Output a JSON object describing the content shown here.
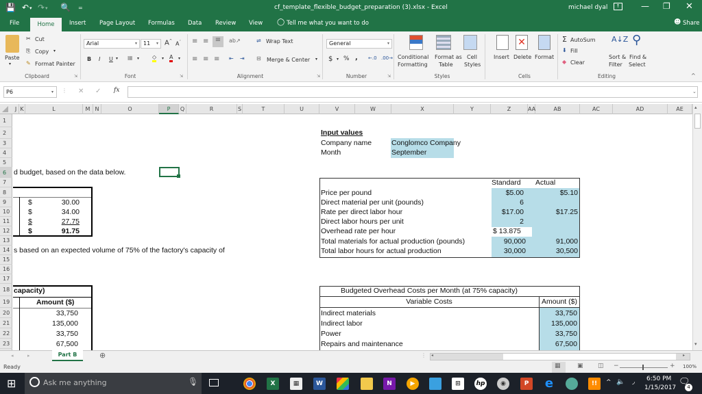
{
  "titlebar": {
    "title": "cf_template_flexible_budget_preparation (3).xlsx  -  Excel",
    "user": "michael dyal",
    "qat": {
      "save": "save-icon",
      "undo": "undo-icon",
      "redo": "redo-icon",
      "print_preview": "print-preview-icon",
      "customize": "customize-qat-icon"
    }
  },
  "menu_tabs": [
    "File",
    "Home",
    "Insert",
    "Page Layout",
    "Formulas",
    "Data",
    "Review",
    "View"
  ],
  "tell_me": "Tell me what you want to do",
  "share": "Share",
  "ribbon": {
    "clipboard": {
      "label": "Clipboard",
      "paste": "Paste",
      "cut": "Cut",
      "copy": "Copy",
      "format_painter": "Format Painter"
    },
    "font": {
      "label": "Font",
      "name": "Arial",
      "size": "11",
      "bold": "B",
      "italic": "I",
      "underline": "U"
    },
    "alignment": {
      "label": "Alignment",
      "wrap_text": "Wrap Text",
      "merge_center": "Merge & Center"
    },
    "number": {
      "label": "Number",
      "format": "General",
      "currency": "$",
      "percent": "%",
      "comma": ","
    },
    "styles": {
      "label": "Styles",
      "conditional": [
        "Conditional",
        "Formatting"
      ],
      "format_table": [
        "Format as",
        "Table"
      ],
      "cell_styles": [
        "Cell",
        "Styles"
      ]
    },
    "cells": {
      "label": "Cells",
      "insert": "Insert",
      "delete": "Delete",
      "format": "Format"
    },
    "editing": {
      "label": "Editing",
      "autosum": "AutoSum",
      "fill": "Fill",
      "clear": "Clear",
      "sort_filter": [
        "Sort &",
        "Filter"
      ],
      "find_select": [
        "Find &",
        "Select"
      ]
    }
  },
  "formula_bar": {
    "name_box": "P6",
    "formula": ""
  },
  "columns": [
    "J",
    "K",
    "L",
    "M",
    "N",
    "O",
    "P",
    "Q",
    "R",
    "S",
    "T",
    "U",
    "V",
    "W",
    "X",
    "Y",
    "Z",
    "AA",
    "AB",
    "AC",
    "AD",
    "AE"
  ],
  "rows": [
    "1",
    "2",
    "3",
    "4",
    "5",
    "6",
    "7",
    "8",
    "9",
    "10",
    "11",
    "12",
    "13",
    "14",
    "15",
    "16",
    "17",
    "18",
    "19",
    "20",
    "21",
    "22",
    "23"
  ],
  "sheet": {
    "row6_text": "d budget, based on the data below.",
    "left_table": {
      "rows": [
        {
          "sym": "$",
          "val": "30.00"
        },
        {
          "sym": "$",
          "val": "34.00"
        },
        {
          "sym": "$",
          "val": "27.75"
        }
      ],
      "total": {
        "sym": "$",
        "val": "91.75"
      }
    },
    "row14_text": "s based on an expected volume of 75% of the factory's capacity of",
    "left_overhead": {
      "header": "capacity)",
      "col_header": "Amount ($)",
      "values": [
        "33,750",
        "135,000",
        "33,750",
        "67,500"
      ]
    },
    "input_values": {
      "title": "Input values",
      "company_label": "Company name",
      "company_value": "Conglomco Company",
      "month_label": "Month",
      "month_value": "September"
    },
    "standards": {
      "col_standard": "Standard",
      "col_actual": "Actual",
      "rows": [
        {
          "label": "Price per pound",
          "standard": "$5.00",
          "actual": "$5.10"
        },
        {
          "label": "Direct material per unit (pounds)",
          "standard": "6",
          "actual": ""
        },
        {
          "label": "Rate per direct labor hour",
          "standard": "$17.00",
          "actual": "$17.25"
        },
        {
          "label": "Direct labor hours per unit",
          "standard": "2",
          "actual": ""
        },
        {
          "label": "Overhead rate per hour",
          "standard": "$ 13.875",
          "actual": ""
        },
        {
          "label": "Total materials for actual production (pounds)",
          "standard": "90,000",
          "actual": "91,000"
        },
        {
          "label": "Total labor hours for actual production",
          "standard": "30,000",
          "actual": "30,500"
        }
      ]
    },
    "overhead": {
      "title": "Budgeted Overhead Costs per Month (at 75% capacity)",
      "col_label": "Variable Costs",
      "col_amount": "Amount ($)",
      "rows": [
        {
          "label": "Indirect materials",
          "amount": "33,750"
        },
        {
          "label": "Indirect labor",
          "amount": "135,000"
        },
        {
          "label": "Power",
          "amount": "33,750"
        },
        {
          "label": "Repairs and maintenance",
          "amount": "67,500"
        }
      ]
    }
  },
  "sheet_tabs": [
    "Part B"
  ],
  "status": {
    "text": "Ready",
    "zoom": "100%"
  },
  "taskbar": {
    "search_placeholder": "Ask me anything",
    "time": "6:50 PM",
    "date": "1/15/2017",
    "notifications": "4"
  },
  "colors": {
    "excel_green": "#217346",
    "input_blue": "#b7dde8"
  }
}
